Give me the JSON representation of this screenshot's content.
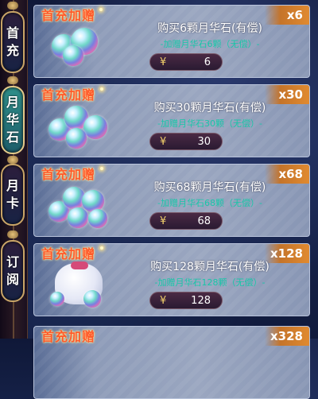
{
  "sidebar": {
    "tabs": [
      {
        "label_chars": [
          "首",
          "充"
        ],
        "active": false
      },
      {
        "label_chars": [
          "月",
          "华",
          "石"
        ],
        "active": true
      },
      {
        "label_chars": [
          "月",
          "卡"
        ],
        "active": false
      },
      {
        "label_chars": [
          "订",
          "阅"
        ],
        "active": false
      }
    ]
  },
  "cards": [
    {
      "badge": "首充加赠",
      "qty": "x6",
      "title": "购买6颗月华石(有偿)",
      "subtitle": "-加赠月华石6颗（无偿）-",
      "currency": "¥",
      "price": "6",
      "icon": "moonstone-gems-icon"
    },
    {
      "badge": "首充加赠",
      "qty": "x30",
      "title": "购买30颗月华石(有偿)",
      "subtitle": "-加赠月华石30颗（无偿）-",
      "currency": "¥",
      "price": "30",
      "icon": "moonstone-gems-icon"
    },
    {
      "badge": "首充加赠",
      "qty": "x68",
      "title": "购买68颗月华石(有偿)",
      "subtitle": "-加赠月华石68颗（无偿）-",
      "currency": "¥",
      "price": "68",
      "icon": "moonstone-gems-icon"
    },
    {
      "badge": "首充加赠",
      "qty": "x128",
      "title": "购买128颗月华石(有偿)",
      "subtitle": "-加赠月华石128颗（无偿）-",
      "currency": "¥",
      "price": "128",
      "icon": "moonstone-bag-icon"
    },
    {
      "badge": "首充加赠",
      "qty": "x328",
      "title": "",
      "subtitle": "",
      "currency": "",
      "price": "",
      "icon": ""
    }
  ],
  "colors": {
    "subtitle": "#18c7a8",
    "badge": "#ff5a2a",
    "qty_tag": "#e08a30"
  }
}
